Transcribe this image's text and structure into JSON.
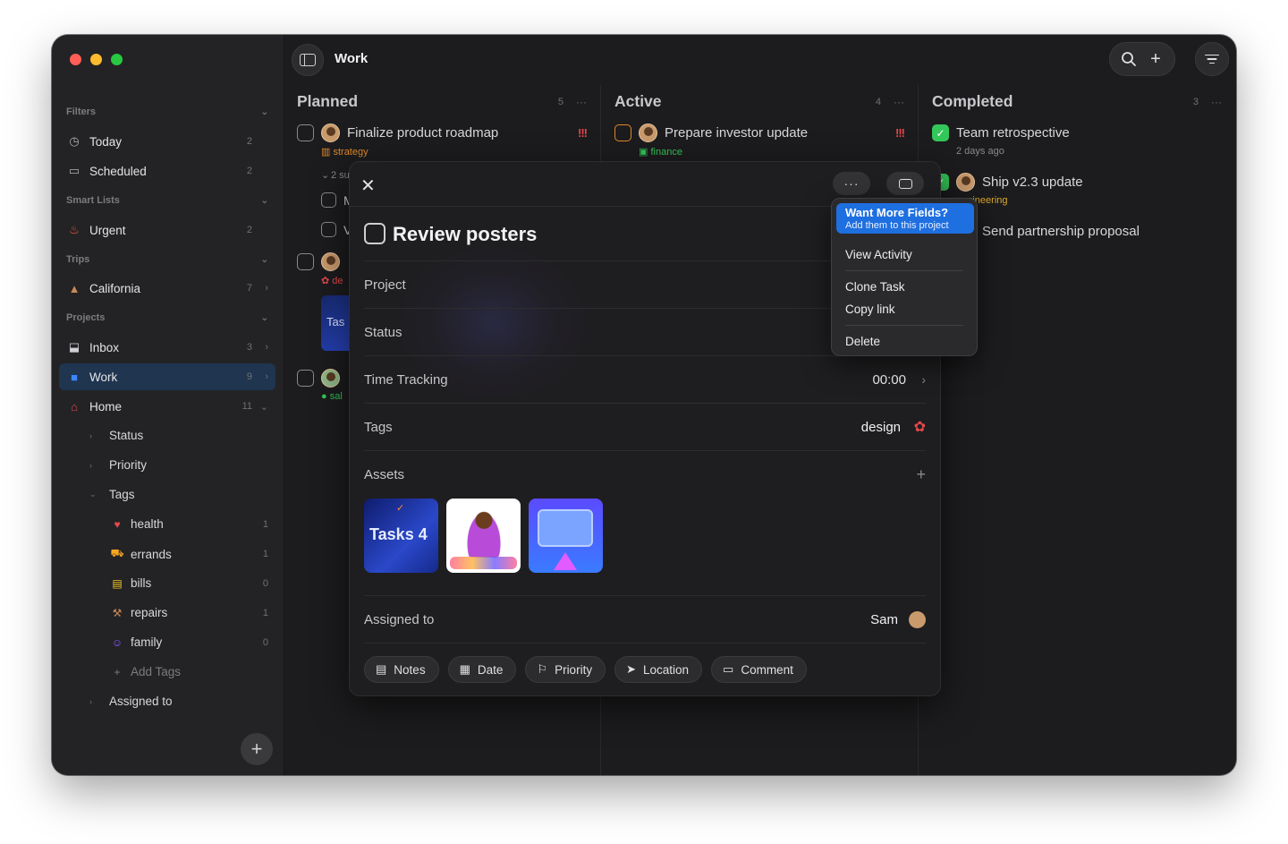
{
  "sidebar": {
    "filters_label": "Filters",
    "smart_lists_label": "Smart Lists",
    "trips_label": "Trips",
    "projects_label": "Projects",
    "items": [
      {
        "label": "Today",
        "count": "2"
      },
      {
        "label": "Scheduled",
        "count": "2"
      },
      {
        "label": "Urgent",
        "count": "2"
      },
      {
        "label": "California",
        "count": "7"
      },
      {
        "label": "Inbox",
        "count": "3"
      },
      {
        "label": "Work",
        "count": "9"
      },
      {
        "label": "Home",
        "count": "11"
      }
    ],
    "home_sub": [
      {
        "label": "Status"
      },
      {
        "label": "Priority"
      },
      {
        "label": "Tags"
      }
    ],
    "tags": [
      {
        "label": "health",
        "count": "1"
      },
      {
        "label": "errands",
        "count": "1"
      },
      {
        "label": "bills",
        "count": "0"
      },
      {
        "label": "repairs",
        "count": "1"
      },
      {
        "label": "family",
        "count": "0"
      }
    ],
    "add_tags_label": "Add Tags",
    "assigned_to_label": "Assigned to"
  },
  "toolbar": {
    "title": "Work"
  },
  "columns": [
    {
      "title": "Planned",
      "count": "5",
      "tasks": [
        {
          "title": "Finalize product roadmap",
          "tag": "strategy",
          "priority": "!!!"
        }
      ],
      "subtask_toggle": "2 su",
      "subtask_1": "M",
      "subtask_2": "V",
      "tag_fragment_1": "de",
      "tag_fragment_2": "sal",
      "card_fragment": "Tas"
    },
    {
      "title": "Active",
      "count": "4",
      "tasks": [
        {
          "title": "Prepare investor update",
          "tag": "finance",
          "priority": "!!!"
        }
      ]
    },
    {
      "title": "Completed",
      "count": "3",
      "tasks": [
        {
          "title": "Team retrospective",
          "meta": "2 days ago"
        },
        {
          "title": "Ship v2.3 update",
          "tag": "engineering"
        },
        {
          "title": "Send partnership proposal",
          "tag": "ales"
        }
      ]
    }
  ],
  "modal": {
    "title": "Review posters",
    "fields": {
      "project": "Project",
      "status": "Status",
      "time_tracking": "Time Tracking",
      "time_value": "00:00",
      "tags": "Tags",
      "tag_value": "design",
      "assets": "Assets",
      "assigned_to": "Assigned to",
      "assignee": "Sam"
    },
    "asset_1_text": "Tasks 4",
    "actions": {
      "notes": "Notes",
      "date": "Date",
      "priority": "Priority",
      "location": "Location",
      "comment": "Comment"
    }
  },
  "menu": {
    "promo_title": "Want More Fields?",
    "promo_sub": "Add them to this project",
    "view_activity": "View Activity",
    "clone_task": "Clone Task",
    "copy_link": "Copy link",
    "delete": "Delete"
  },
  "colors": {
    "accent": "#1e6fe0",
    "priority": "#e5484d",
    "done": "#34c759"
  }
}
